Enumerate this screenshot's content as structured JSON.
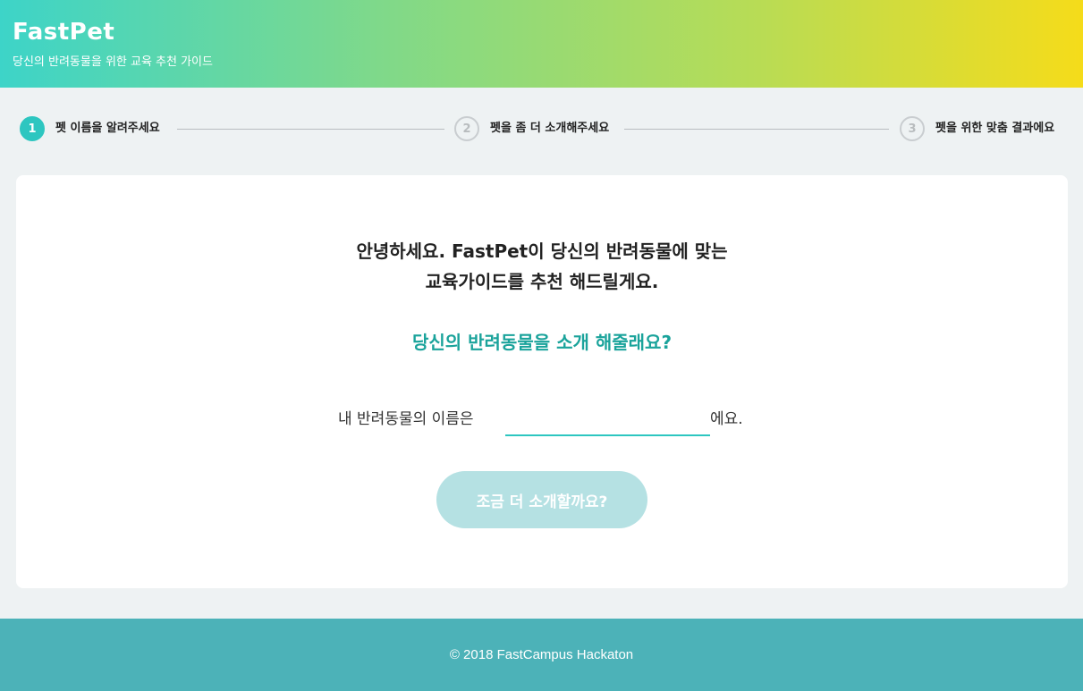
{
  "header": {
    "logo": "FastPet",
    "tagline": "당신의 반려동물을 위한 교육 추천 가이드"
  },
  "stepper": {
    "steps": [
      {
        "number": "1",
        "label": "펫 이름을 알려주세요",
        "state": "active"
      },
      {
        "number": "2",
        "label": "펫을 좀 더 소개해주세요",
        "state": "inactive"
      },
      {
        "number": "3",
        "label": "펫을 위한 맞춤 결과에요",
        "state": "inactive"
      }
    ]
  },
  "main": {
    "intro_line1": "안녕하세요. FastPet이 당신의 반려동물에 맞는",
    "intro_line2": "교육가이드를 추천 해드릴게요.",
    "question": "당신의 반려동물을 소개 해줄래요?",
    "name_prefix": "내 반려동물의 이름은",
    "name_value": "",
    "name_suffix": "에요.",
    "next_button_label": "조금 더 소개할까요?"
  },
  "footer": {
    "copyright": "© 2018 FastCampus Hackaton"
  },
  "colors": {
    "accent": "#2dc6c0",
    "question": "#1aa39b",
    "button_disabled": "#b5e1e3",
    "footer": "#4cb2b8"
  }
}
